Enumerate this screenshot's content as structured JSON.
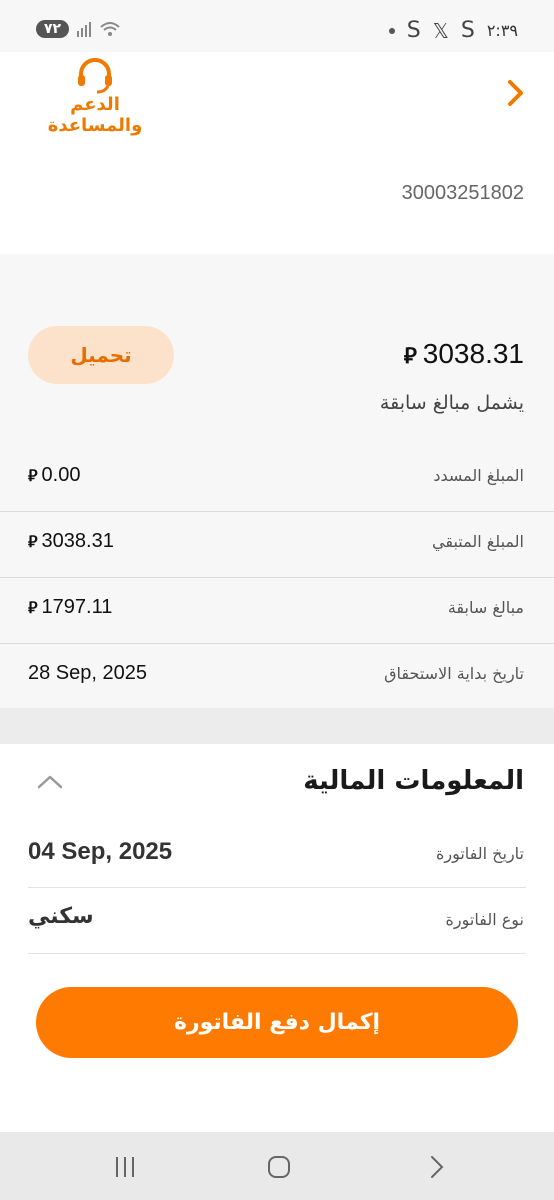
{
  "status_bar": {
    "battery": "٧٢",
    "time": "٢:٣٩",
    "icons": [
      "dot-icon",
      "s-app-icon",
      "x-app-icon",
      "s-app-icon"
    ],
    "x_glyph": "𝕏",
    "s_glyph": "S"
  },
  "header": {
    "support_label": "الدعم والمساعدة",
    "account_number": "30003251802"
  },
  "summary": {
    "currency_symbol": "⃁",
    "download_label": "تحميل",
    "total_amount": "3038.31",
    "includes_note": "يشمل مبالغ سابقة",
    "rows": [
      {
        "label": "المبلغ المسدد",
        "value": "0.00"
      },
      {
        "label": "المبلغ المتبقي",
        "value": "3038.31"
      },
      {
        "label": "مبالغ سابقة",
        "value": "1797.11"
      },
      {
        "label": "تاريخ بداية الاستحقاق",
        "value": "28 Sep, 2025"
      }
    ]
  },
  "financial": {
    "title": "المعلومات المالية",
    "rows": [
      {
        "label": "تاريخ الفاتورة",
        "value": "04 Sep, 2025"
      },
      {
        "label": "نوع الفاتورة",
        "value": "سكني"
      }
    ],
    "pay_label": "إكمال دفع الفاتورة"
  },
  "colors": {
    "accent": "#ff7a00",
    "accent_light": "#fde2cb"
  }
}
